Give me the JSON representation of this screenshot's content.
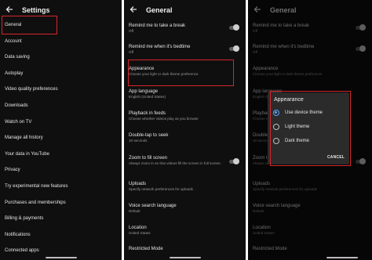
{
  "colors": {
    "background": "#0f0f0f",
    "highlight": "#d7262c",
    "radio_selected": "#5aa4ff"
  },
  "settings_screen": {
    "title": "Settings",
    "back_icon": "arrow-left-icon",
    "items": [
      "General",
      "Account",
      "Data saving",
      "Autoplay",
      "Video quality preferences",
      "Downloads",
      "Watch on TV",
      "Manage all history",
      "Your data in YouTube",
      "Privacy",
      "Try experimental new features",
      "Purchases and memberships",
      "Billing & payments",
      "Notifications",
      "Connected apps"
    ]
  },
  "general_screen": {
    "title": "General",
    "back_icon": "arrow-left-icon",
    "rows": [
      {
        "title": "Remind me to take a break",
        "subtitle": "Off",
        "toggle": false
      },
      {
        "title": "Remind me when it's bedtime",
        "subtitle": "Off",
        "toggle": false
      },
      {
        "title": "Appearance",
        "subtitle": "Choose your light or dark theme preference"
      },
      {
        "title": "App language",
        "subtitle": "English (United States)"
      },
      {
        "title": "Playback in feeds",
        "subtitle": "Choose whether videos play as you browse"
      },
      {
        "title": "Double-tap to seek",
        "subtitle": "10 seconds"
      },
      {
        "title": "Zoom to fill screen",
        "subtitle": "Always zoom in so that videos fill the screen in full screen",
        "toggle": false
      },
      {
        "title": "Uploads",
        "subtitle": "Specify network preferences for uploads"
      },
      {
        "title": "Voice search language",
        "subtitle": "Default"
      },
      {
        "title": "Location",
        "subtitle": "United States"
      },
      {
        "title": "Restricted Mode",
        "subtitle": ""
      }
    ]
  },
  "appearance_dialog": {
    "title": "Appearance",
    "options": [
      {
        "label": "Use device theme",
        "selected": true
      },
      {
        "label": "Light theme",
        "selected": false
      },
      {
        "label": "Dark theme",
        "selected": false
      }
    ],
    "cancel_label": "CANCEL"
  }
}
